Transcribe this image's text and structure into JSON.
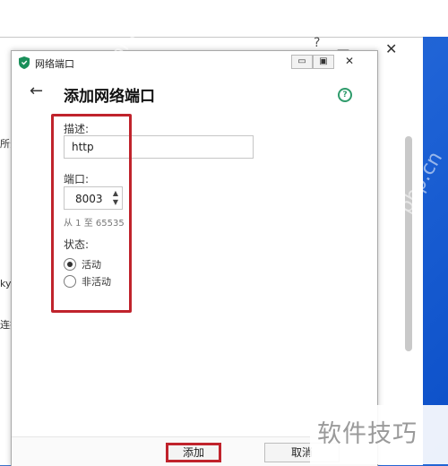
{
  "background_window": {
    "help_symbol": "?",
    "minimize_symbol": "—",
    "close_symbol": "✕",
    "side_text": [
      "所分",
      "ky",
      "连接"
    ]
  },
  "dialog": {
    "window_title": "网络端口",
    "min_symbol": "▭",
    "max_symbol": "▣",
    "close_symbol": "✕",
    "back_symbol": "←",
    "page_title": "添加网络端口",
    "help_symbol": "?",
    "description_label": "描述:",
    "description_value": "http",
    "port_label": "端口:",
    "port_value": "8003",
    "port_range_hint": "从 1 至 65535",
    "status_label": "状态:",
    "status_options": [
      {
        "label": "活动",
        "checked": true
      },
      {
        "label": "非活动",
        "checked": false
      }
    ],
    "add_button": "添加",
    "cancel_button": "取消"
  },
  "watermark": {
    "diagonal_text": "php.cn",
    "corner_text": "软件技巧"
  },
  "colors": {
    "highlight": "#c0232c",
    "help_icon": "#2e9b6b",
    "desktop": "#1f63d6"
  }
}
